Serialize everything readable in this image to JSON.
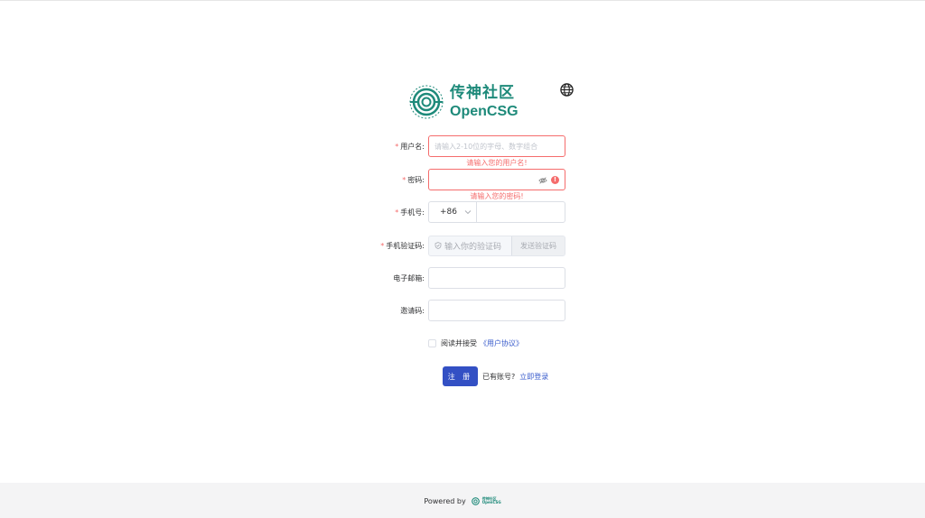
{
  "brand": {
    "name_cn": "传神社区",
    "name_en": "OpenCSG",
    "color": "#1e8a7a"
  },
  "language_icon": "globe-icon",
  "form": {
    "username": {
      "label": "用户名",
      "placeholder": "请输入2-10位的字母、数字组合",
      "error": "请输入您的用户名!"
    },
    "password": {
      "label": "密码",
      "value": "",
      "error": "请输入您的密码!"
    },
    "phone": {
      "label": "手机号",
      "country_code": "+86",
      "value": ""
    },
    "phone_code": {
      "label": "手机验证码",
      "placeholder": "输入你的验证码",
      "send_button": "发送验证码"
    },
    "email": {
      "label": "电子邮箱",
      "value": ""
    },
    "invite": {
      "label": "邀请码",
      "value": ""
    },
    "required_mark": "*",
    "label_suffix": ":"
  },
  "agreement": {
    "text": "阅读并接受",
    "link": "《用户协议》"
  },
  "actions": {
    "submit": "注 册",
    "has_account": "已有账号?",
    "login_link": "立即登录"
  },
  "footer": {
    "powered_by": "Powered by",
    "brand_cn": "传神社区",
    "brand_en": "OpenCSG"
  },
  "colors": {
    "primary": "#3350c4",
    "error": "#f56c6c",
    "link": "#3a5ccc"
  }
}
